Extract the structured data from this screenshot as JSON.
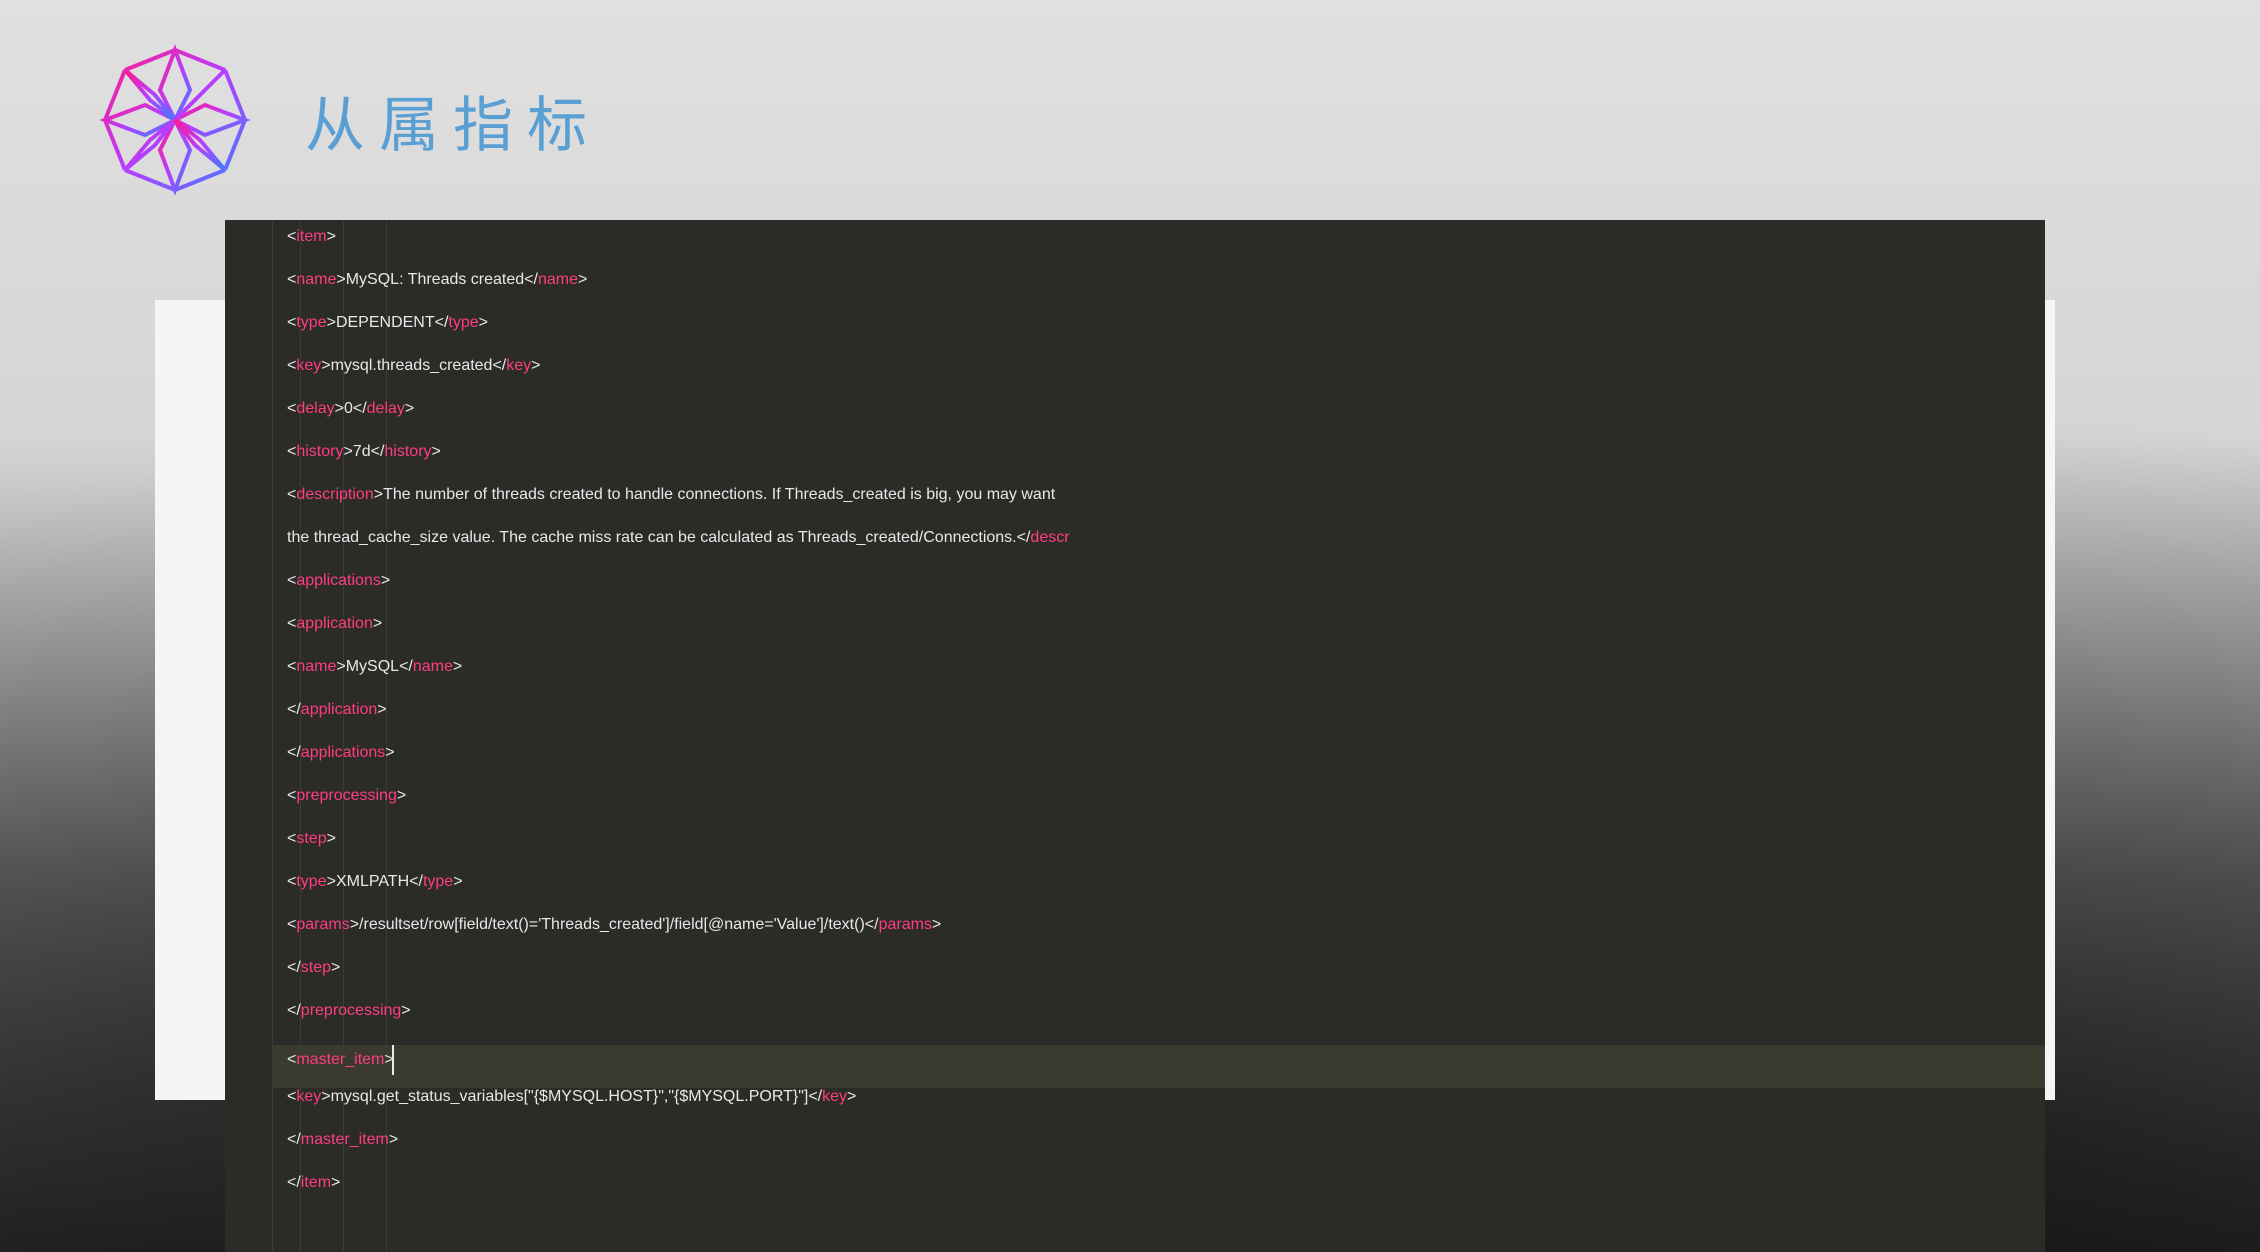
{
  "header": {
    "title": "从属指标"
  },
  "code": {
    "lines": [
      {
        "indent": 0,
        "open": "item",
        "text": "",
        "close": ""
      },
      {
        "indent": 1,
        "open": "name",
        "text": "MySQL: Threads created",
        "close": "name"
      },
      {
        "indent": 1,
        "open": "type",
        "text": "DEPENDENT",
        "close": "type"
      },
      {
        "indent": 1,
        "open": "key",
        "text": "mysql.threads_created",
        "close": "key"
      },
      {
        "indent": 1,
        "open": "delay",
        "text": "0",
        "close": "delay"
      },
      {
        "indent": 1,
        "open": "history",
        "text": "7d",
        "close": "history"
      },
      {
        "indent": 1,
        "open": "description",
        "text": "The number of threads created to handle connections. If Threads_created is big, you may want",
        "close": ""
      },
      {
        "indent": 1,
        "open": "",
        "text": "the thread_cache_size value. The cache miss rate can be calculated as Threads_created/Connections.",
        "close": "descr",
        "closePartial": true
      },
      {
        "indent": 1,
        "open": "applications",
        "text": "",
        "close": ""
      },
      {
        "indent": 2,
        "open": "application",
        "text": "",
        "close": ""
      },
      {
        "indent": 3,
        "open": "name",
        "text": "MySQL",
        "close": "name"
      },
      {
        "indent": 2,
        "open": "",
        "text": "",
        "close": "application",
        "closing": true
      },
      {
        "indent": 1,
        "open": "",
        "text": "",
        "close": "applications",
        "closing": true
      },
      {
        "indent": 1,
        "open": "preprocessing",
        "text": "",
        "close": ""
      },
      {
        "indent": 2,
        "open": "step",
        "text": "",
        "close": ""
      },
      {
        "indent": 3,
        "open": "type",
        "text": "XMLPATH",
        "close": "type"
      },
      {
        "indent": 3,
        "open": "params",
        "text": "/resultset/row[field/text()='Threads_created']/field[@name='Value']/text()",
        "close": "params"
      },
      {
        "indent": 2,
        "open": "",
        "text": "",
        "close": "step",
        "closing": true
      },
      {
        "indent": 1,
        "open": "",
        "text": "",
        "close": "preprocessing",
        "closing": true
      },
      {
        "indent": 1,
        "open": "master_item",
        "text": "",
        "close": "",
        "highlighted": true,
        "cursor": true
      },
      {
        "indent": 2,
        "open": "key",
        "text": "mysql.get_status_variables[\"{$MYSQL.HOST}\",\"{$MYSQL.PORT}\"]",
        "close": "key"
      },
      {
        "indent": 1,
        "open": "",
        "text": "",
        "close": "master_item",
        "closing": true
      },
      {
        "indent": 0,
        "open": "",
        "text": "",
        "close": "item",
        "closing": true
      }
    ]
  }
}
